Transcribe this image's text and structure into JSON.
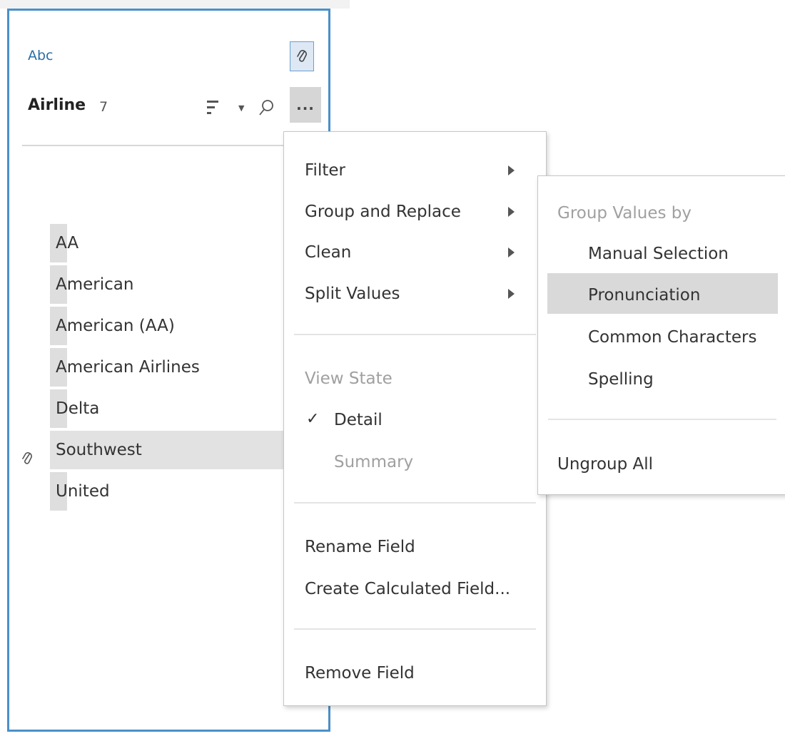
{
  "field_panel": {
    "type_label": "Abc",
    "field_name": "Airline",
    "field_count": "7",
    "more_label": "...",
    "values": [
      {
        "label": "AA"
      },
      {
        "label": "American"
      },
      {
        "label": "American (AA)"
      },
      {
        "label": "American Airlines"
      },
      {
        "label": "Delta"
      },
      {
        "label": "Southwest",
        "selected": true
      },
      {
        "label": "United"
      }
    ]
  },
  "context_menu": {
    "filter": "Filter",
    "group_and_replace": "Group and Replace",
    "clean": "Clean",
    "split_values": "Split Values",
    "view_state_header": "View State",
    "detail_check": "✓",
    "detail": "Detail",
    "summary": "Summary",
    "rename_field": "Rename Field",
    "create_calculated_field": "Create Calculated Field...",
    "remove_field": "Remove Field"
  },
  "group_submenu": {
    "header": "Group Values by",
    "manual_selection": "Manual Selection",
    "pronunciation": "Pronunciation",
    "common_characters": "Common Characters",
    "spelling": "Spelling",
    "ungroup_all": "Ungroup All",
    "highlighted_item": "Pronunciation"
  },
  "colors": {
    "panel_border": "#4a90c9",
    "type_label": "#2a6ea8",
    "highlight": "#d9d9d9",
    "disabled_text": "#a0a0a0"
  },
  "icons": [
    "paperclip-icon",
    "sort-icon",
    "caret-down-icon",
    "search-icon",
    "more-icon",
    "chevron-right-icon",
    "checkmark-icon"
  ]
}
